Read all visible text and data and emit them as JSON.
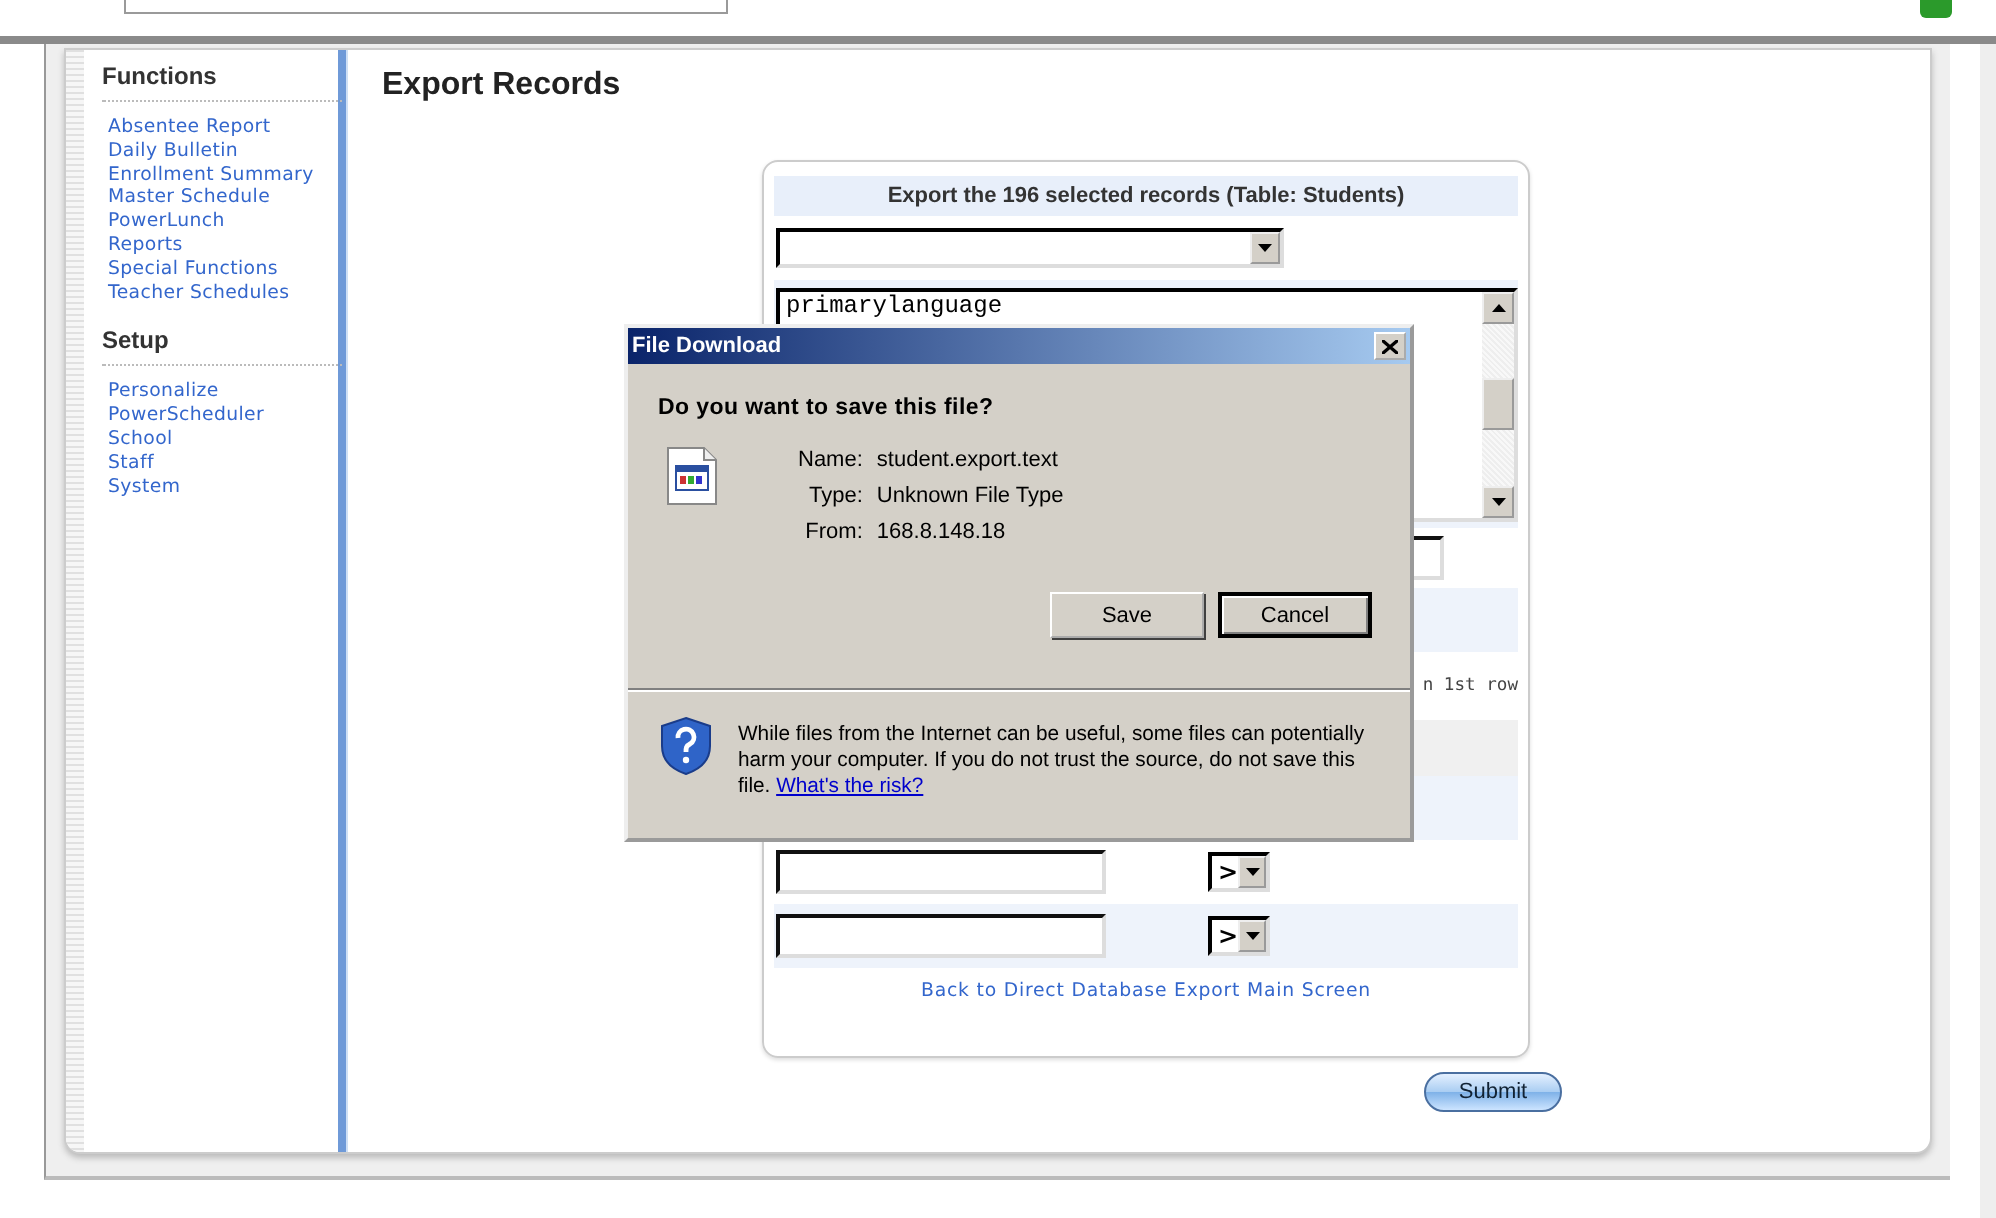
{
  "sidebar": {
    "sections": [
      {
        "title": "Functions",
        "items": [
          "Absentee Report",
          "Daily Bulletin",
          "Enrollment Summary",
          "Master Schedule",
          "PowerLunch",
          "Reports",
          "Special Functions",
          "Teacher Schedules"
        ]
      },
      {
        "title": "Setup",
        "items": [
          "Personalize",
          "PowerScheduler",
          "School",
          "Staff",
          "System"
        ]
      }
    ]
  },
  "page_title": "Export Records",
  "form": {
    "header": "Export the 196 selected records (Table: Students)",
    "fields_list": [
      "primarylanguage"
    ],
    "row_label": "n 1st row",
    "filter_rows": [
      {
        "operator": ">"
      },
      {
        "operator": ">"
      }
    ],
    "back_link": "Back to Direct Database Export Main Screen"
  },
  "submit": "Submit",
  "dialog": {
    "title": "File Download",
    "question": "Do you want to save this file?",
    "details": [
      {
        "label": "Name:",
        "value": "student.export.text"
      },
      {
        "label": "Type:",
        "value": "Unknown File Type"
      },
      {
        "label": "From:",
        "value": "168.8.148.18"
      }
    ],
    "buttons": [
      {
        "label": "Save",
        "default": false
      },
      {
        "label": "Cancel",
        "default": true
      }
    ],
    "warning": "While files from the Internet can be useful, some files can potentially harm your computer. If you do not trust the source, do not save this file.",
    "risk_link": "What's the risk?"
  }
}
